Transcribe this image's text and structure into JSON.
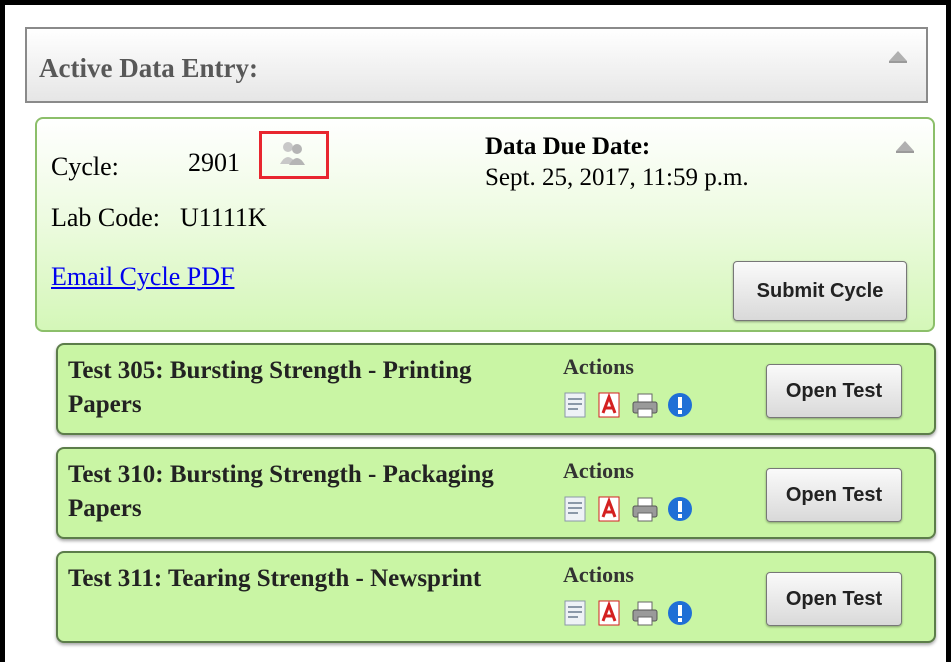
{
  "header": {
    "title": "Active Data Entry:"
  },
  "cycle": {
    "cycle_label": "Cycle:",
    "cycle_number": "2901",
    "lab_code_label": "Lab Code:",
    "lab_code": "U1111K",
    "due_label": "Data Due Date:",
    "due_value": "Sept. 25, 2017, 11:59 p.m.",
    "email_link": "Email Cycle PDF",
    "submit_label": "Submit Cycle"
  },
  "tests": [
    {
      "title": "Test 305: Bursting Strength - Printing Papers",
      "actions_label": "Actions",
      "open_label": "Open Test"
    },
    {
      "title": "Test 310: Bursting Strength - Packaging Papers",
      "actions_label": "Actions",
      "open_label": "Open Test"
    },
    {
      "title": "Test 311: Tearing Strength - Newsprint",
      "actions_label": "Actions",
      "open_label": "Open Test"
    }
  ],
  "colors": {
    "cycle_panel": "#d4f7b8",
    "test_panel": "#c9f5a4",
    "highlight_border": "#e8262f",
    "link": "#0000ee",
    "info_icon": "#1f6fd6",
    "pdf_icon": "#d42020"
  },
  "icons": [
    "collapse-icon",
    "users-icon",
    "document-icon",
    "pdf-icon",
    "print-icon",
    "info-icon"
  ]
}
